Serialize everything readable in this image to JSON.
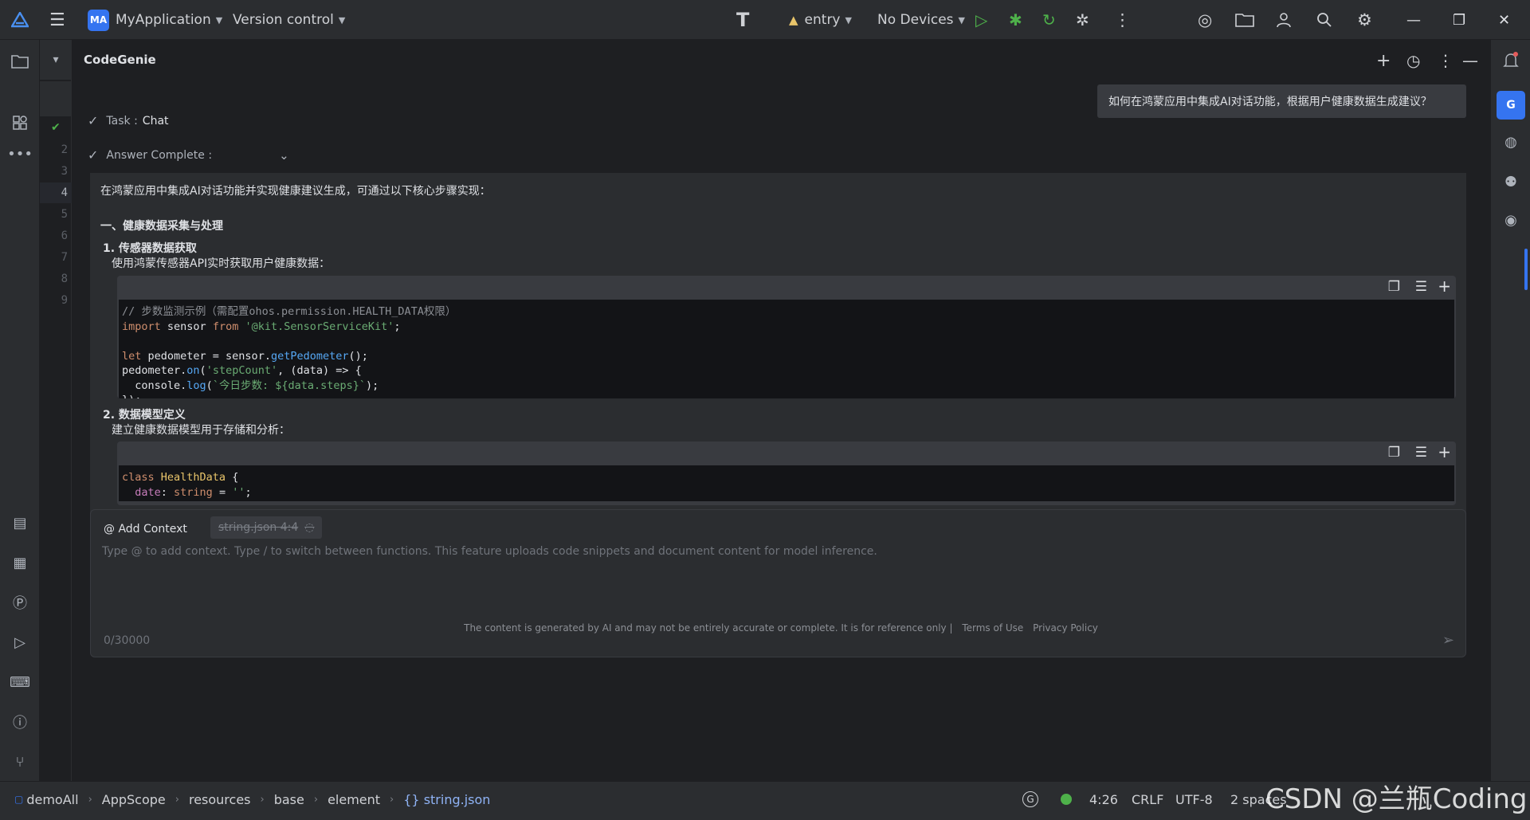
{
  "titlebar": {
    "project_initials": "MA",
    "project_name": "MyApplication",
    "vcs": "Version control",
    "module": "entry",
    "device": "No Devices"
  },
  "editor": {
    "line_numbers": [
      "2",
      "3",
      "4",
      "5",
      "6",
      "7",
      "8",
      "9"
    ]
  },
  "panel": {
    "title": "CodeGenie",
    "user_question": "如何在鸿蒙应用中集成AI对话功能，根据用户健康数据生成建议？",
    "task_label": "Task :",
    "task_value": "Chat",
    "answer_status": "Answer Complete :",
    "answer": {
      "intro": "在鸿蒙应用中集成AI对话功能并实现健康建议生成，可通过以下核心步骤实现：",
      "section1": "一、健康数据采集与处理",
      "step1_title": "1. 传感器数据获取",
      "step1_desc": "使用鸿蒙传感器API实时获取用户健康数据：",
      "step2_title": "2. 数据模型定义",
      "step2_desc": "建立健康数据模型用于存储和分析："
    },
    "input": {
      "add_context": "@ Add Context",
      "context_file": "string.json 4:4",
      "placeholder": "Type @ to add context. Type / to switch between functions. This feature uploads code snippets and document content for model inference.",
      "counter": "0/30000"
    },
    "disclaimer": "The content is generated by AI and may not be entirely accurate or complete. It is for reference only  |",
    "terms": "Terms of Use",
    "privacy": "Privacy Policy"
  },
  "statusbar": {
    "breadcrumbs": [
      "demoAll",
      "AppScope",
      "resources",
      "base",
      "element",
      "{} string.json"
    ],
    "position": "4:26",
    "line_sep": "CRLF",
    "encoding": "UTF-8",
    "indent": "2 spaces"
  },
  "watermark": "CSDN @兰瓶Coding",
  "colors": {
    "accent": "#3574f0",
    "status_ok": "#4eb14a"
  }
}
